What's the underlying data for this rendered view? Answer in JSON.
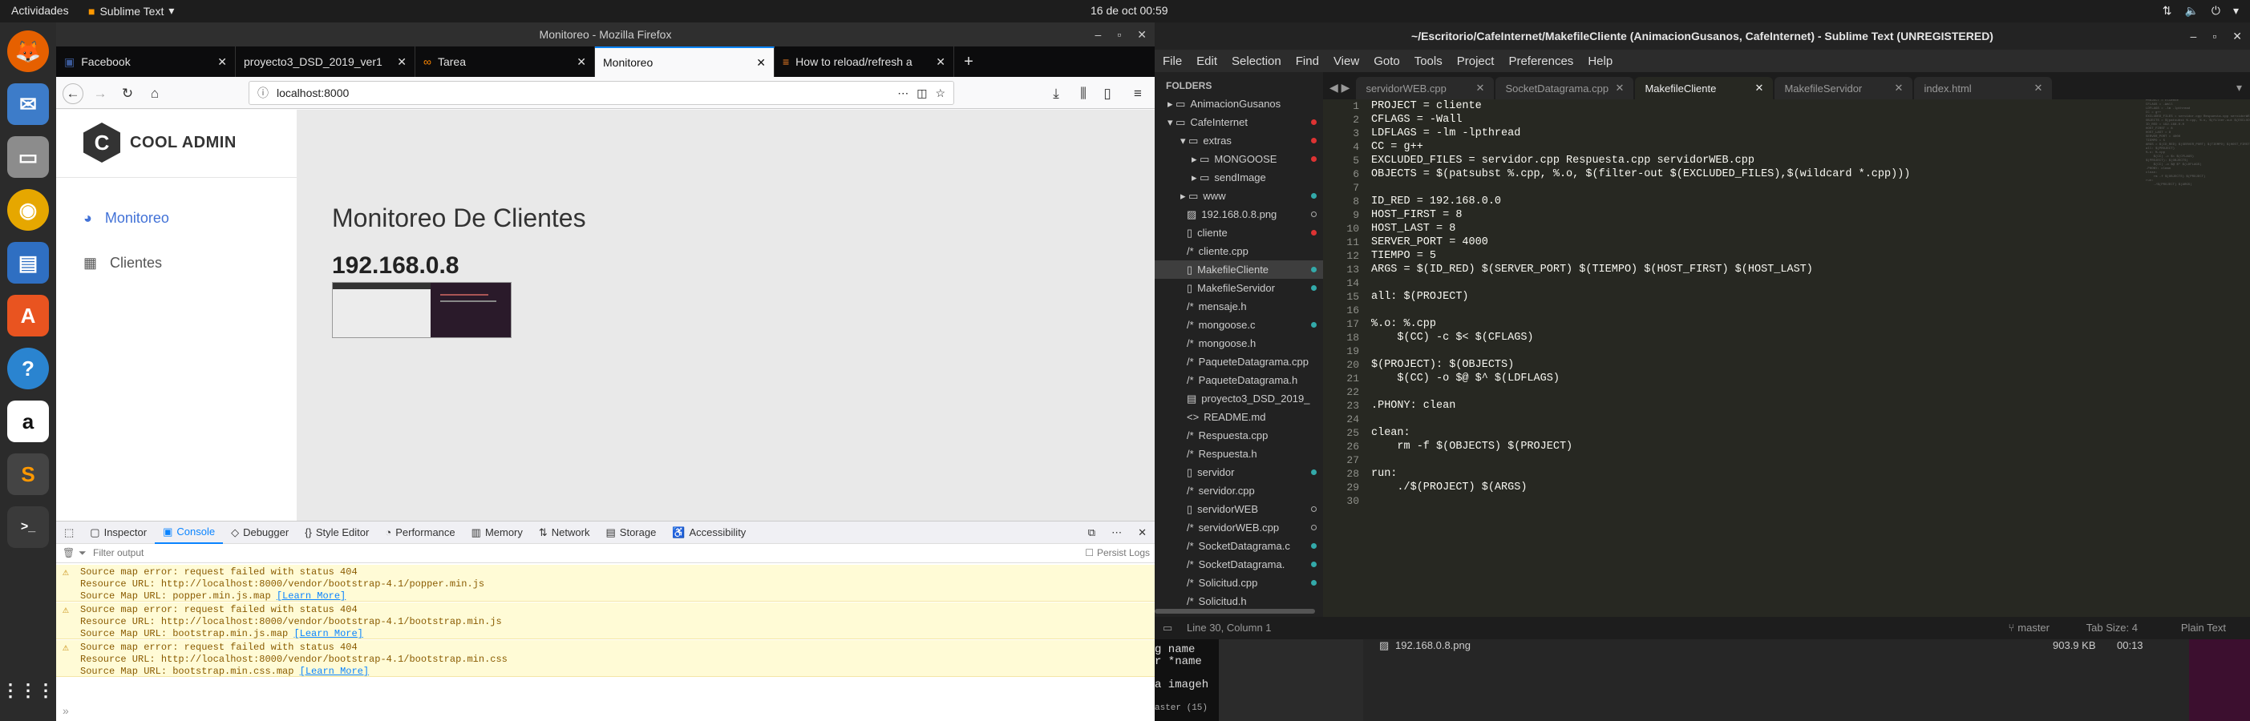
{
  "topbar": {
    "activities": "Actividades",
    "app_menu": "Sublime Text",
    "clock": "16 de oct 00:59"
  },
  "firefox": {
    "window_title": "Monitoreo - Mozilla Firefox",
    "tabs": [
      {
        "label": "Facebook"
      },
      {
        "label": "proyecto3_DSD_2019_ver1"
      },
      {
        "label": "Tarea"
      },
      {
        "label": "Monitoreo"
      },
      {
        "label": "How to reload/refresh a"
      }
    ],
    "url": "localhost:8000",
    "page": {
      "logo_text": "COOL ADMIN",
      "logo_letter": "C",
      "nav": [
        {
          "label": "Monitoreo"
        },
        {
          "label": "Clientes"
        }
      ],
      "title": "Monitoreo De Clientes",
      "client_ip": "192.168.0.8"
    },
    "devtools": {
      "tabs": [
        "Inspector",
        "Console",
        "Debugger",
        "Style Editor",
        "Performance",
        "Memory",
        "Network",
        "Storage",
        "Accessibility"
      ],
      "filter_placeholder": "Filter output",
      "persist_logs": "Persist Logs",
      "errors": [
        {
          "line1": "Source map error: request failed with status 404",
          "line2": "Resource URL: http://localhost:8000/vendor/bootstrap-4.1/popper.min.js",
          "line3": "Source Map URL: popper.min.js.map",
          "learn": "[Learn More]"
        },
        {
          "line1": "Source map error: request failed with status 404",
          "line2": "Resource URL: http://localhost:8000/vendor/bootstrap-4.1/bootstrap.min.js",
          "line3": "Source Map URL: bootstrap.min.js.map",
          "learn": "[Learn More]"
        },
        {
          "line1": "Source map error: request failed with status 404",
          "line2": "Resource URL: http://localhost:8000/vendor/bootstrap-4.1/bootstrap.min.css",
          "line3": "Source Map URL: bootstrap.min.css.map",
          "learn": "[Learn More]"
        }
      ]
    }
  },
  "sublime": {
    "window_title": "~/Escritorio/CafeInternet/MakefileCliente (AnimacionGusanos, CafeInternet) - Sublime Text (UNREGISTERED)",
    "menu": [
      "File",
      "Edit",
      "Selection",
      "Find",
      "View",
      "Goto",
      "Tools",
      "Project",
      "Preferences",
      "Help"
    ],
    "folders_label": "FOLDERS",
    "tree": [
      "AnimacionGusanos",
      "CafeInternet",
      "extras",
      "MONGOOSE",
      "sendImage",
      "www",
      "192.168.0.8.png",
      "cliente",
      "cliente.cpp",
      "MakefileCliente",
      "MakefileServidor",
      "mensaje.h",
      "mongoose.c",
      "mongoose.h",
      "PaqueteDatagrama.cpp",
      "PaqueteDatagrama.h",
      "proyecto3_DSD_2019_",
      "README.md",
      "Respuesta.cpp",
      "Respuesta.h",
      "servidor",
      "servidor.cpp",
      "servidorWEB",
      "servidorWEB.cpp",
      "SocketDatagrama.c",
      "SocketDatagrama.",
      "Solicitud.cpp",
      "Solicitud.h"
    ],
    "tabs": [
      "servidorWEB.cpp",
      "SocketDatagrama.cpp",
      "MakefileCliente",
      "MakefileServidor",
      "index.html"
    ],
    "code": [
      "PROJECT = cliente",
      "CFLAGS = -Wall",
      "LDFLAGS = -lm -lpthread",
      "CC = g++",
      "EXCLUDED_FILES = servidor.cpp Respuesta.cpp servidorWEB.cpp",
      "OBJECTS = $(patsubst %.cpp, %.o, $(filter-out $(EXCLUDED_FILES),$(wildcard *.cpp)))",
      "",
      "ID_RED = 192.168.0.0",
      "HOST_FIRST = 8",
      "HOST_LAST = 8",
      "SERVER_PORT = 4000",
      "TIEMPO = 5",
      "ARGS = $(ID_RED) $(SERVER_PORT) $(TIEMPO) $(HOST_FIRST) $(HOST_LAST)",
      "",
      "all: $(PROJECT)",
      "",
      "%.o: %.cpp",
      "    $(CC) -c $< $(CFLAGS)",
      "",
      "$(PROJECT): $(OBJECTS)",
      "    $(CC) -o $@ $^ $(LDFLAGS)",
      "",
      ".PHONY: clean",
      "",
      "clean:",
      "    rm -f $(OBJECTS) $(PROJECT)",
      "",
      "run:",
      "    ./$(PROJECT) $(ARGS)",
      ""
    ],
    "status": {
      "position": "Line 30, Column 1",
      "branch": "master",
      "tab_size": "Tab Size: 4",
      "syntax": "Plain Text"
    },
    "below": {
      "file": "192.168.0.8.png",
      "size": "903.9 KB",
      "time": "00:13",
      "term1": "g name",
      "term2": "r *name",
      "term3": "a imageh",
      "term4": "aster (15)"
    }
  }
}
